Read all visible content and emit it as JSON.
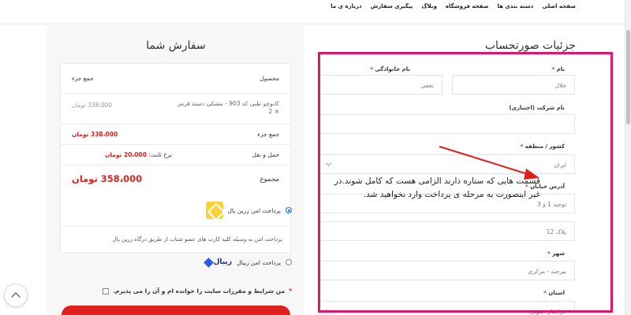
{
  "nav": {
    "items": [
      "صفحه اصلی",
      "دسته بندی ها",
      "صفحه فروشگاه",
      "وبلاگ",
      "پیگیری سفارش",
      "درباره ی ما"
    ]
  },
  "order": {
    "title": "سفارش شما",
    "header_product": "محصول",
    "header_subtotal": "جمع جزء",
    "item_name": "کانوچو طبی کد 903 - مشکی دسته قرمز",
    "item_qty": "× 2",
    "item_price": "338،000 تومان",
    "subtotal_label": "جمع جزء",
    "subtotal_value": "338،000 تومان",
    "shipping_label": "حمل و نقل",
    "shipping_rate_label": "نرخ ثابت:",
    "shipping_rate_value": "20،000 تومان",
    "total_label": "مجموع",
    "total_value": "358،000 تومان"
  },
  "payment": {
    "zarinpal_label": "پرداخت امن زرین پال",
    "zarinpal_desc": "پرداخت امن به وسیله کلیه کارت های عضو شتاب از طریق درگاه زرین پال",
    "zibal_label": "پرداخت امن زیبال",
    "zibal_logo": "زیبال",
    "terms_text": "من شرایط و مقررات سایت را خوانده ام و آن را می پذیرم.",
    "terms_req": "*"
  },
  "billing": {
    "title": "جزئیات صورتحساب",
    "first_name_label": "نام",
    "first_name_value": "جلال",
    "last_name_label": "نام خانوادگی",
    "last_name_value": "نخعی",
    "company_label": "نام شرکت (اختیاری)",
    "country_label": "کشور / منطقه",
    "country_value": "ایران",
    "address_label": "آدرس خیابان",
    "address_value": "توحید 1 و 3",
    "address2_value": "پلاک 12",
    "city_label": "شهر",
    "city_value": "بیرجند - مرکزی",
    "state_label": "استان",
    "state_value": "خراسان جنوبی",
    "req": "*"
  },
  "annotation": {
    "text": "قسمت هایی که ستاره دارند الزامی هست که کامل شوند.در غیر اینصورت به مرحله ی پرداخت وارد نخواهید شد."
  },
  "colors": {
    "accent_red": "#e0201f",
    "highlight_pink": "#e0166e",
    "zarinpal_yellow": "#fbd23a",
    "zibal_blue": "#2d5ae8"
  }
}
